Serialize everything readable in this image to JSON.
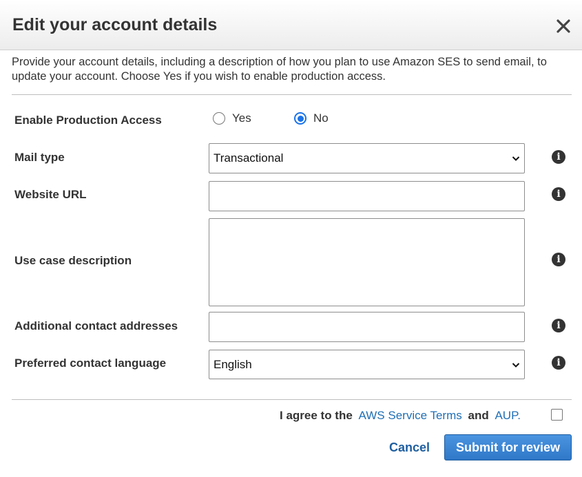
{
  "dialog": {
    "title": "Edit your account details",
    "intro": "Provide your account details, including a description of how you plan to use Amazon SES to send email, to update your account. Choose Yes if you wish to enable production access."
  },
  "form": {
    "production_access": {
      "label": "Enable Production Access",
      "options": [
        {
          "label": "Yes",
          "checked": false
        },
        {
          "label": "No",
          "checked": true
        }
      ]
    },
    "mail_type": {
      "label": "Mail type",
      "value": "Transactional"
    },
    "website_url": {
      "label": "Website URL",
      "value": ""
    },
    "use_case": {
      "label": "Use case description",
      "value": ""
    },
    "additional_contacts": {
      "label": "Additional contact addresses",
      "value": ""
    },
    "preferred_language": {
      "label": "Preferred contact language",
      "value": "English"
    }
  },
  "agreement": {
    "prefix": "I agree to the",
    "terms_link": "AWS Service Terms",
    "middle": "and",
    "aup_link": "AUP.",
    "checked": false
  },
  "actions": {
    "cancel_label": "Cancel",
    "submit_label": "Submit for review"
  },
  "colors": {
    "accent": "#1a73e8",
    "link": "#1f6fb5",
    "submit_bg": "#3a84d4"
  },
  "icons": {
    "close": "close-icon",
    "info": "info-icon",
    "dropdown": "chevron-down-icon"
  }
}
